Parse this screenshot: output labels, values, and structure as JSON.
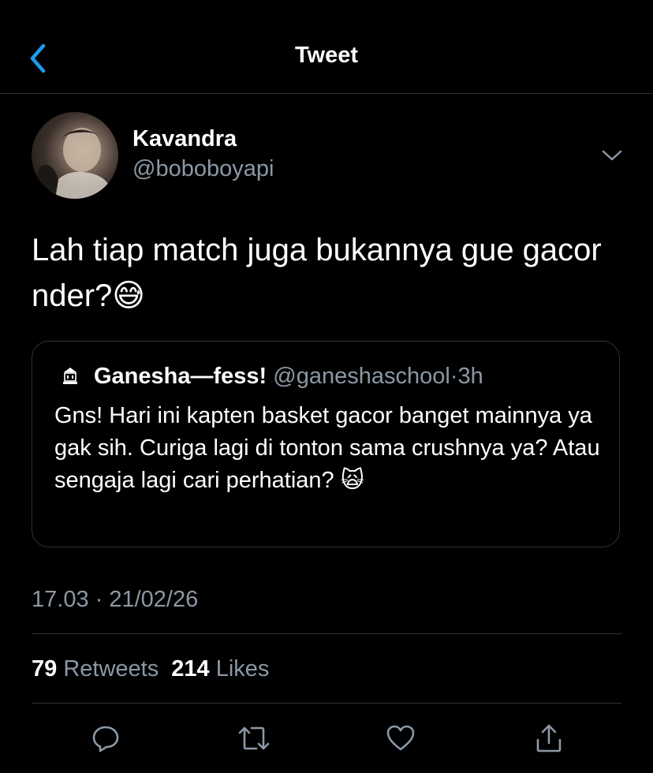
{
  "header": {
    "title": "Tweet",
    "back_icon": "chevron-left-icon"
  },
  "tweet": {
    "author": {
      "display_name": "Kavandra",
      "handle": "@boboboyapi"
    },
    "text": "Lah tiap match juga bukannya gue gacor nder?😅",
    "timestamp": "17.03 · 21/02/26",
    "stats": {
      "retweets_count": "79",
      "retweets_label": "Retweets",
      "likes_count": "214",
      "likes_label": "Likes"
    }
  },
  "quote": {
    "display_name": "Ganesha—fess!",
    "handle": "@ganeshaschool",
    "separator": "·",
    "time": "3h",
    "text": "Gns! Hari ini kapten basket gacor banget mainnya ya gak sih. Curiga lagi di tonton sama crushnya ya? Atau sengaja lagi cari perhatian? 🙀"
  },
  "actions": [
    "reply-icon",
    "retweet-icon",
    "like-icon",
    "share-icon"
  ],
  "colors": {
    "background": "#000000",
    "accent": "#1d9bf0",
    "secondary_text": "#8b98a5",
    "divider": "#2f3336"
  }
}
